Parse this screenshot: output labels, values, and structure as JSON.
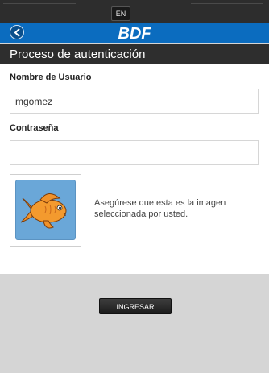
{
  "topbar": {
    "language": "EN"
  },
  "brand": {
    "logo_text": "BDF"
  },
  "header": {
    "title": "Proceso de autenticación"
  },
  "form": {
    "username_label": "Nombre de Usuario",
    "username_value": "mgomez",
    "password_label": "Contraseña",
    "password_value": ""
  },
  "security_image": {
    "icon": "goldfish-icon",
    "note": "Asegúrese que esta es la imagen seleccionada por usted."
  },
  "actions": {
    "submit_label": "INGRESAR"
  },
  "colors": {
    "brand_blue": "#0b6cbf",
    "dark_bar": "#2e2e2e",
    "fish_bg": "#6aa7d8",
    "fish": "#f0922a"
  }
}
